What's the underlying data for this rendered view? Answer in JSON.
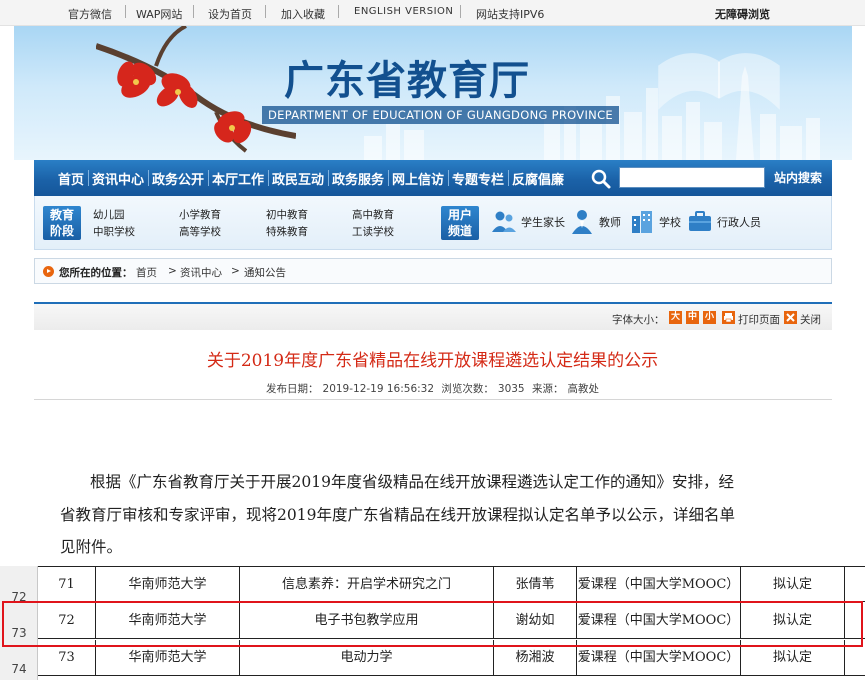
{
  "topbar": {
    "links": [
      "官方微信",
      "WAP网站",
      "设为首页",
      "加入收藏",
      "ENGLISH VERSION",
      "网站支持IPV6"
    ],
    "accessibility": "无障碍浏览"
  },
  "banner": {
    "title": "广东省教育厅",
    "subtitle": "DEPARTMENT OF EDUCATION OF GUANGDONG PROVINCE"
  },
  "nav": {
    "items": [
      "首页",
      "资讯中心",
      "政务公开",
      "本厅工作",
      "政民互动",
      "政务服务",
      "网上信访",
      "专题专栏",
      "反腐倡廉"
    ],
    "search_placeholder": "",
    "search_button": "站内搜索"
  },
  "channels": {
    "stage_label_1": "教育",
    "stage_label_2": "阶段",
    "stage_links": [
      "幼儿园",
      "小学教育",
      "初中教育",
      "高中教育",
      "中职学校",
      "高等学校",
      "特殊教育",
      "工读学校"
    ],
    "user_label_1": "用户",
    "user_label_2": "频道",
    "user_links": [
      "学生家长",
      "教师",
      "学校",
      "行政人员"
    ]
  },
  "breadcrumb": {
    "label": "您所在的位置：",
    "items": [
      "首页",
      "资讯中心",
      "通知公告"
    ],
    "sep": ">"
  },
  "toolbar": {
    "font_size_label": "字体大小：",
    "sizes": [
      "大",
      "中",
      "小"
    ],
    "print": "打印页面",
    "close": "关闭"
  },
  "article": {
    "title": "关于2019年度广东省精品在线开放课程遴选认定结果的公示",
    "date_label": "发布日期：",
    "date": "2019-12-19 16:56:32",
    "views_label": "浏览次数：",
    "views": "3035",
    "source_label": "来源：",
    "source": "高教处",
    "paragraph_lines": [
      "根据《广东省教育厅关于开展2019年度省级精品在线开放课程遴选认定工作的通知》安排，经",
      "省教育厅审核和专家评审，现将2019年度广东省精品在线开放课程拟认定名单予以公示，详细名单",
      "见附件。"
    ]
  },
  "table": {
    "row_numbers": [
      "72",
      "73",
      "74"
    ],
    "rows": [
      [
        "71",
        "华南师范大学",
        "信息素养：开启学术研究之门",
        "张倩苇",
        "爱课程（中国大学MOOC）",
        "拟认定"
      ],
      [
        "72",
        "华南师范大学",
        "电子书包教学应用",
        "谢幼如",
        "爱课程（中国大学MOOC）",
        "拟认定"
      ],
      [
        "73",
        "华南师范大学",
        "电动力学",
        "杨湘波",
        "爱课程（中国大学MOOC）",
        "拟认定"
      ]
    ]
  },
  "colors": {
    "nav_blue": "#1b62a8",
    "title_red": "#d42a16",
    "highlight_red": "#e0141b",
    "accent_orange": "#e8650e"
  }
}
